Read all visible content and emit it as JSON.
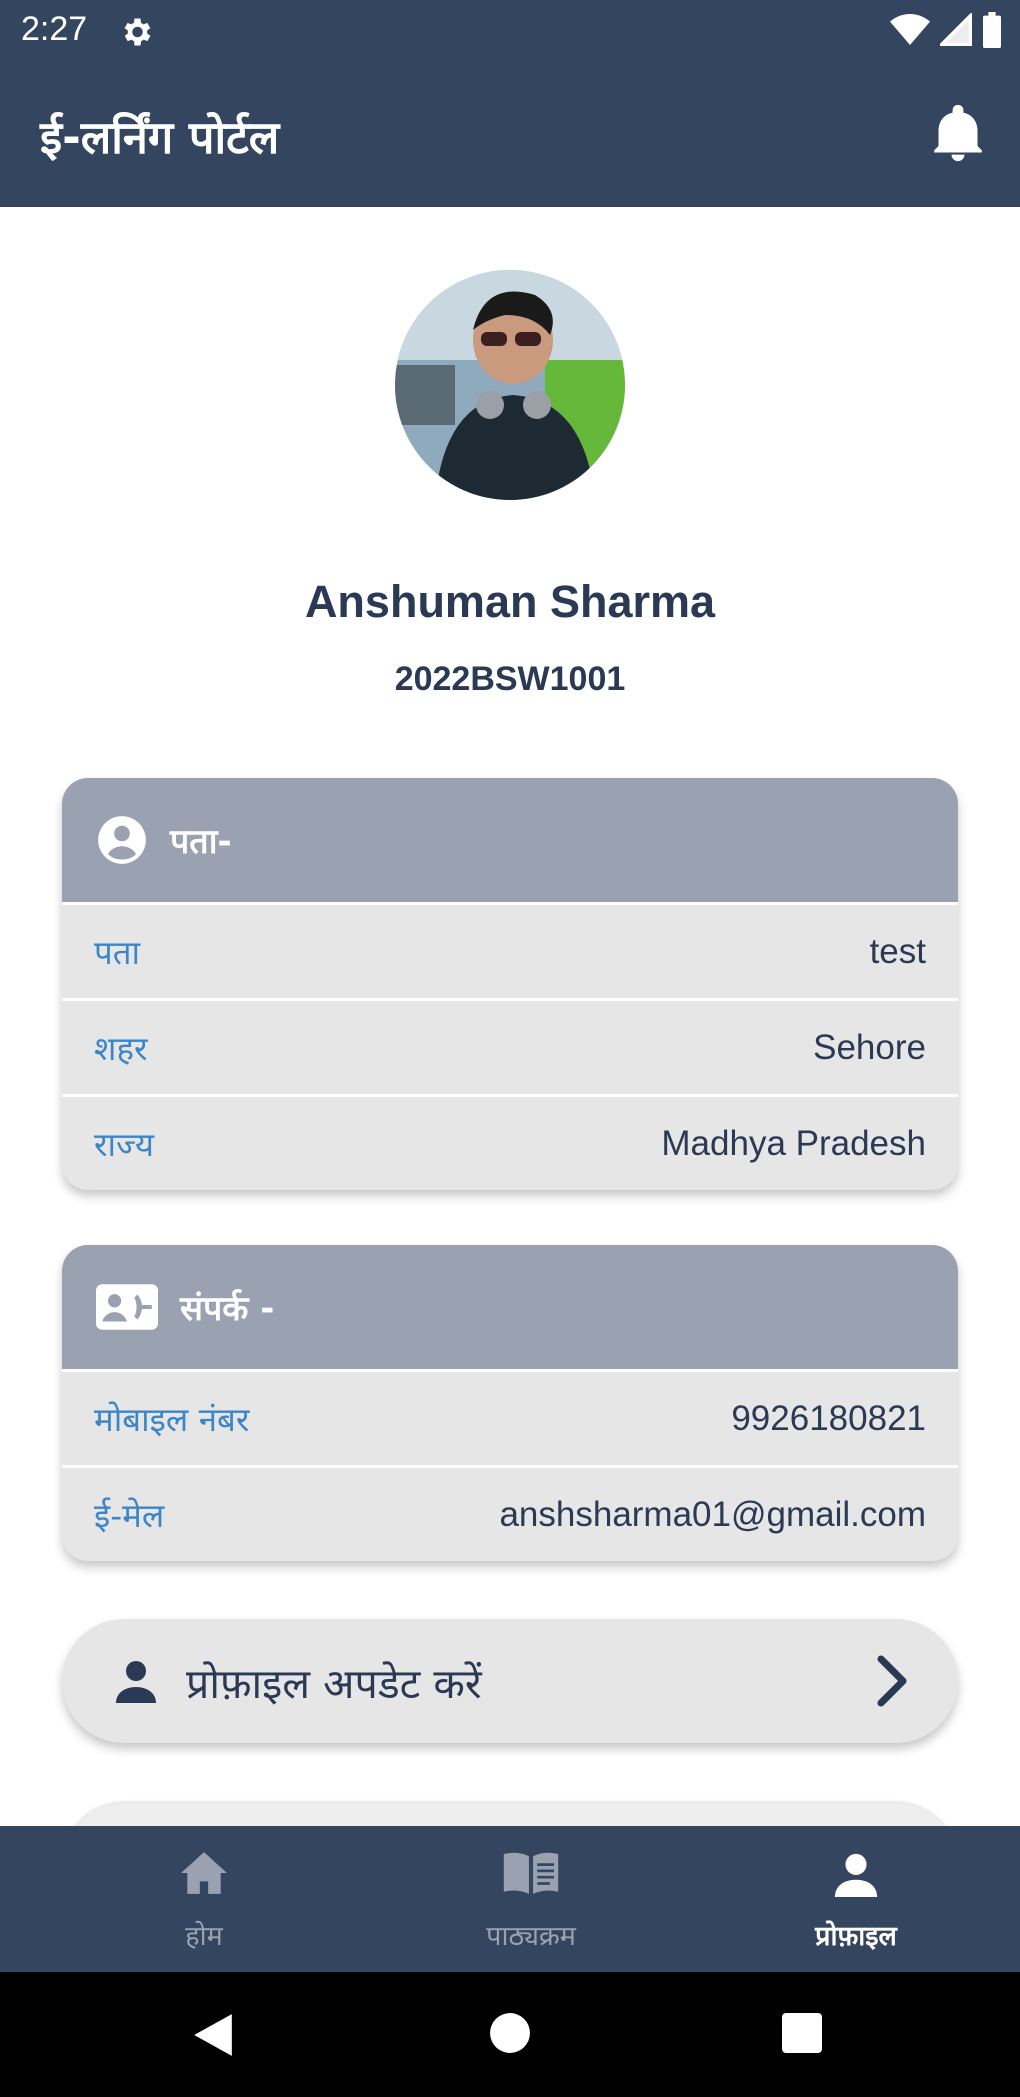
{
  "status": {
    "time": "2:27"
  },
  "appbar": {
    "title": "ई-लर्निंग पोर्टल"
  },
  "profile": {
    "name": "Anshuman Sharma",
    "id": "2022BSW1001"
  },
  "address_card": {
    "title": "पता-",
    "rows": [
      {
        "label": "पता",
        "value": "test"
      },
      {
        "label": "शहर",
        "value": "Sehore"
      },
      {
        "label": "राज्य",
        "value": "Madhya Pradesh"
      }
    ]
  },
  "contact_card": {
    "title": "संपर्क -",
    "rows": [
      {
        "label": "मोबाइल नंबर",
        "value": "9926180821"
      },
      {
        "label": "ई-मेल",
        "value": "anshsharma01@gmail.com"
      }
    ]
  },
  "update_button": {
    "label": "प्रोफ़ाइल अपडेट करें"
  },
  "bottom_nav": [
    {
      "label": "होम",
      "icon": "home-icon"
    },
    {
      "label": "पाठ्यक्रम",
      "icon": "book-icon"
    },
    {
      "label": "प्रोफ़ाइल",
      "icon": "person-icon",
      "active": true
    }
  ],
  "colors": {
    "primary": "#34465f",
    "card_header": "#9aa2b1",
    "label_blue": "#3a86c8",
    "text_dark": "#2a3a55"
  }
}
